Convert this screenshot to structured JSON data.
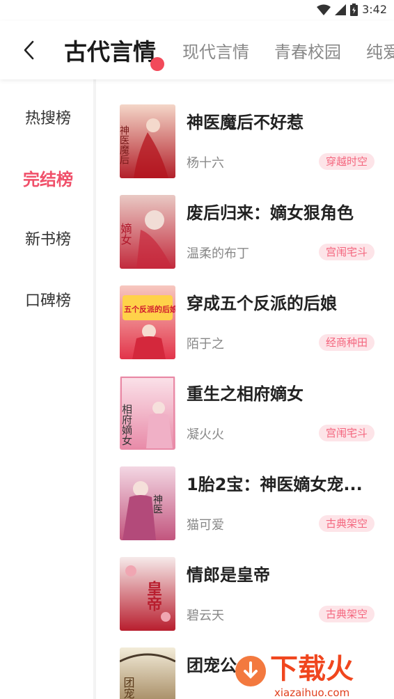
{
  "status_bar": {
    "time": "3:42"
  },
  "tabs": [
    {
      "label": "古代言情",
      "active": true
    },
    {
      "label": "现代言情",
      "active": false
    },
    {
      "label": "青春校园",
      "active": false
    },
    {
      "label": "纯爱",
      "active": false
    }
  ],
  "sidebar": {
    "items": [
      {
        "label": "热搜榜",
        "active": false
      },
      {
        "label": "完结榜",
        "active": true
      },
      {
        "label": "新书榜",
        "active": false
      },
      {
        "label": "口碑榜",
        "active": false
      }
    ]
  },
  "books": [
    {
      "title": "神医魔后不好惹",
      "author": "杨十六",
      "tag": "穿越时空",
      "cover_text": "神医魔后",
      "cover_colors": [
        "#f4d6c8",
        "#b3202a"
      ]
    },
    {
      "title": "废后归来：嫡女狠角色",
      "author": "温柔的布丁",
      "tag": "宫闱宅斗",
      "cover_text": "嫡女",
      "cover_colors": [
        "#e9c9c4",
        "#c22a3c"
      ]
    },
    {
      "title": "穿成五个反派的后娘",
      "author": "陌于之",
      "tag": "经商种田",
      "cover_text": "五个反派的后娘",
      "cover_colors": [
        "#f7c8c0",
        "#e2344a"
      ]
    },
    {
      "title": "重生之相府嫡女",
      "author": "凝火火",
      "tag": "宫闱宅斗",
      "cover_text": "相府嫡女",
      "cover_colors": [
        "#fbe3ea",
        "#e88aa8"
      ]
    },
    {
      "title": "1胎2宝：神医嫡女宠...",
      "author": "猫可爱",
      "tag": "古典架空",
      "cover_text": "神医",
      "cover_colors": [
        "#f3d7e3",
        "#c2557e"
      ]
    },
    {
      "title": "情郎是皇帝",
      "author": "碧云天",
      "tag": "古典架空",
      "cover_text": "皇帝",
      "cover_colors": [
        "#f6eaea",
        "#b81e2e"
      ]
    },
    {
      "title": "团宠公",
      "author": "",
      "tag": "",
      "cover_text": "团宠",
      "cover_colors": [
        "#f3ecd9",
        "#8c6b3c"
      ]
    }
  ],
  "watermark": {
    "text": "下载火",
    "url": "xiazaihuo.com"
  },
  "icons": {
    "back": "chevron-left-icon",
    "wifi": "wifi-icon",
    "signal": "signal-icon",
    "battery": "battery-icon"
  },
  "colors": {
    "accent": "#f0506a",
    "tag_bg": "#fde4e8",
    "tag_text": "#f4667e"
  }
}
